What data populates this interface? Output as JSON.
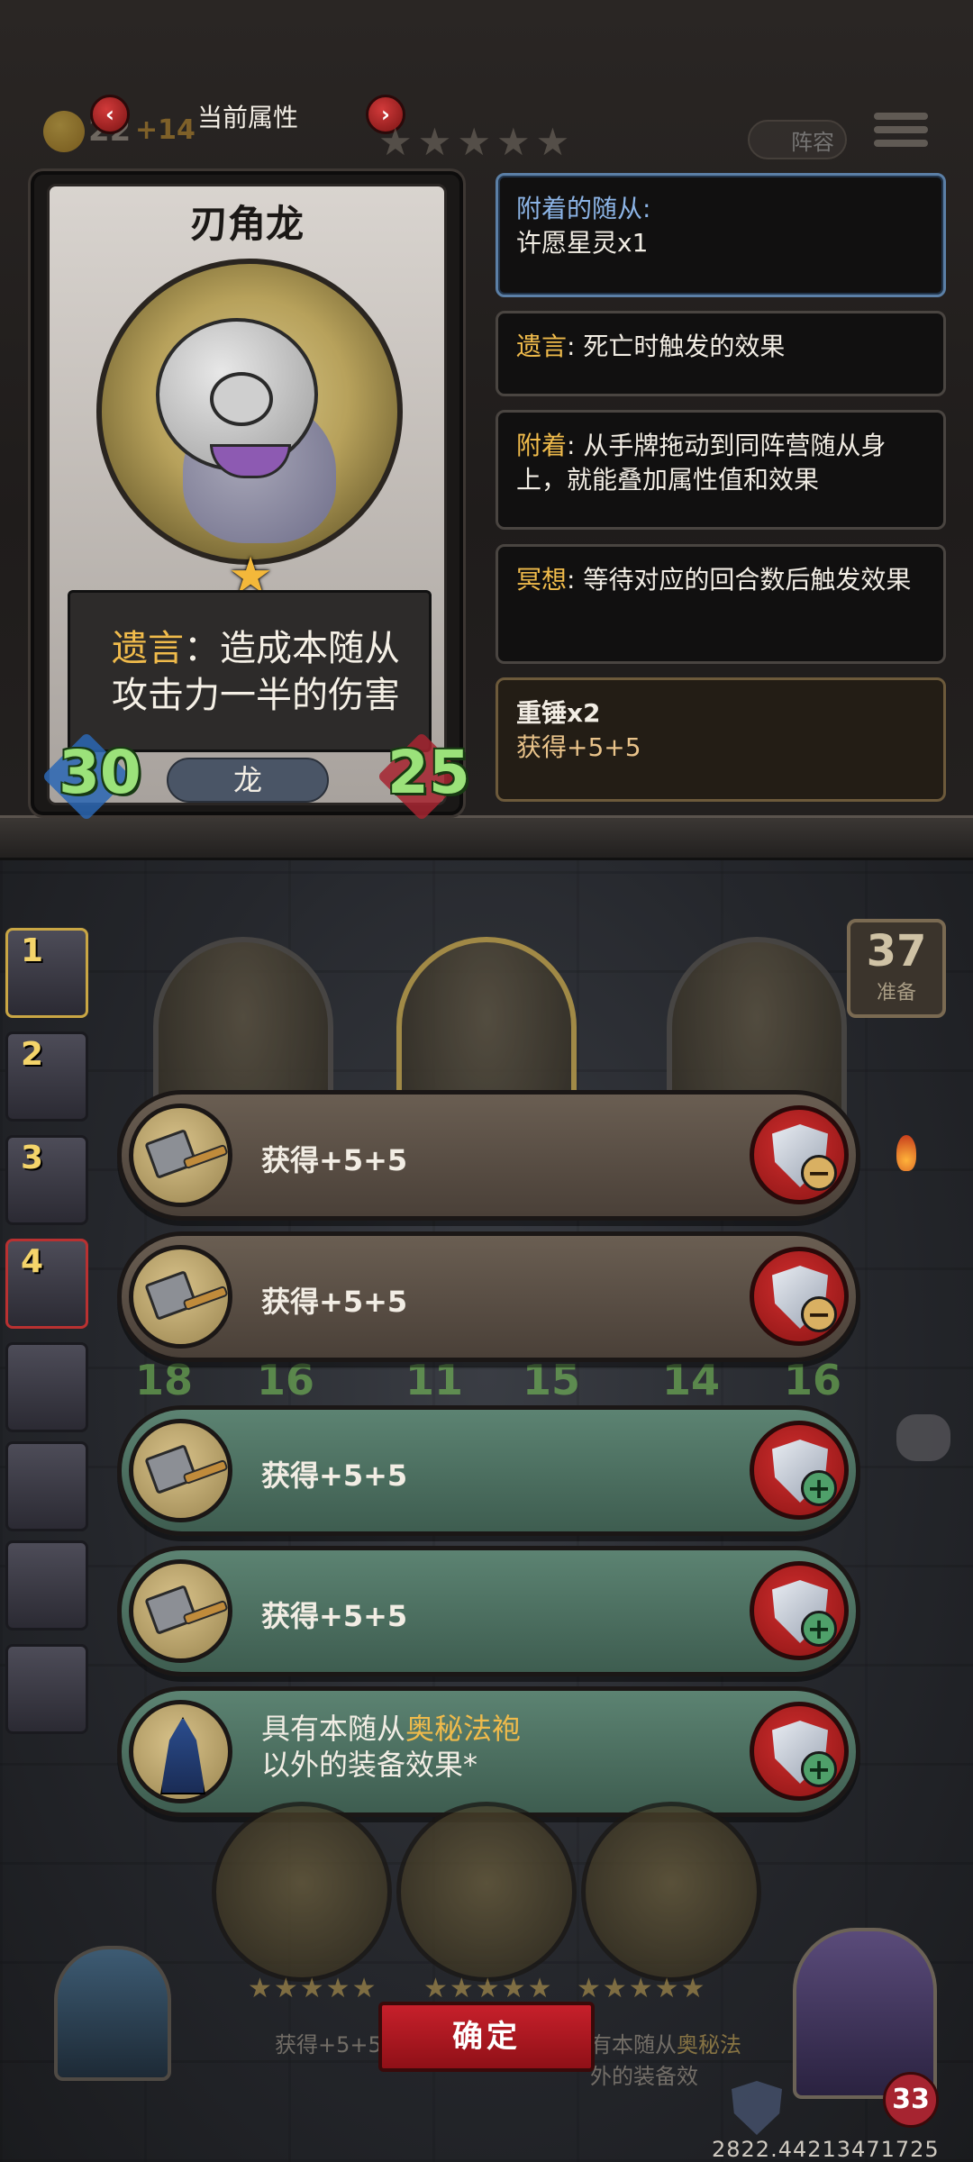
{
  "header": {
    "title": "当前属性",
    "prev_arrow": "‹",
    "next_arrow": "›",
    "gold": "22",
    "gold_bonus": "+14",
    "lineup_label": "阵容"
  },
  "unit_card": {
    "name": "刃角龙",
    "desc_keyword": "遗言",
    "desc_sep": "：",
    "desc_line1_rest": "造成本随从",
    "desc_line2": "攻击力一半的伤害",
    "attack": "30",
    "health": "25",
    "tribe": "龙",
    "star": "★"
  },
  "keyword_panels": [
    {
      "title": "附着的随从:",
      "body": "许愿星灵x1"
    },
    {
      "keyword": "遗言",
      "body": ": 死亡时触发的效果"
    },
    {
      "keyword": "附着",
      "body": ": 从手牌拖动到同阵营随从身上，就能叠加属性值和效果"
    },
    {
      "keyword": "冥想",
      "body": ": 等待对应的回合数后触发效果"
    },
    {
      "title": "重锤x2",
      "body": "获得+5+5"
    }
  ],
  "board": {
    "turn_number": "37",
    "turn_label": "准备",
    "side_slots": [
      "1",
      "2",
      "3",
      "4"
    ],
    "stats": [
      "18",
      "16",
      "11",
      "15",
      "14",
      "16"
    ]
  },
  "equip_rows": [
    {
      "label": "获得+5+5",
      "action": "remove"
    },
    {
      "label": "获得+5+5",
      "action": "remove"
    },
    {
      "label": "获得+5+5",
      "action": "add"
    },
    {
      "label": "获得+5+5",
      "action": "add"
    },
    {
      "label_pre": "具有本随从",
      "label_kw": "奥秘法袍",
      "label_line2": "以外的装备效果*",
      "action": "add"
    }
  ],
  "bottom": {
    "confirm_label": "确定",
    "left_text": "获得+5+5",
    "right_text_pre": "有本随从",
    "right_text_kw": "奥秘法",
    "right_text_line2": "外的装备效",
    "hero_hp": "33",
    "coords": "2822.44213471725",
    "stars": "★★★★★"
  },
  "colors": {
    "keyword": "#f0bb4b",
    "attached_title": "#8cb4e6",
    "stat_green": "#9be27a",
    "remove_row": "#5a4e44",
    "add_row": "#4e7262",
    "confirm_red": "#c7202b"
  },
  "icons": {
    "prev": "chevron-left-icon",
    "next": "chevron-right-icon",
    "remove": "shield-minus-icon",
    "add": "shield-plus-icon",
    "hammer": "hammer-icon",
    "robe": "robe-icon",
    "menu": "menu-icon",
    "chat": "chat-icon"
  }
}
